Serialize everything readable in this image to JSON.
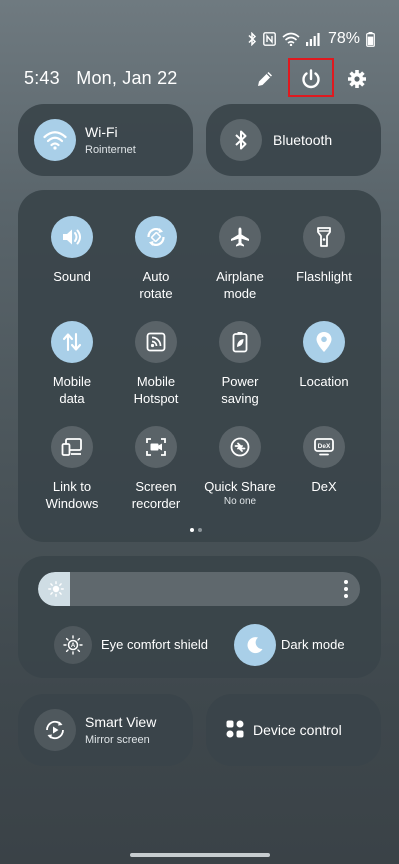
{
  "status_bar": {
    "battery": "78%",
    "icons": [
      "bluetooth-icon",
      "nfc-icon",
      "wifi-icon",
      "signal-icon",
      "battery-icon"
    ]
  },
  "header": {
    "time": "5:43",
    "date": "Mon, Jan 22",
    "icons": [
      "pencil-icon",
      "power-icon",
      "gear-icon"
    ]
  },
  "wifi": {
    "title": "Wi-Fi",
    "subtitle": "Rointernet",
    "state": "on"
  },
  "bluetooth": {
    "title": "Bluetooth",
    "state": "off"
  },
  "quick_settings": [
    {
      "label": "Sound",
      "icon": "speaker-icon",
      "state": "on"
    },
    {
      "label": "Auto\nrotate",
      "icon": "rotate-icon",
      "state": "on"
    },
    {
      "label": "Airplane\nmode",
      "icon": "airplane-icon",
      "state": "off"
    },
    {
      "label": "Flashlight",
      "icon": "flashlight-icon",
      "state": "off"
    },
    {
      "label": "Mobile\ndata",
      "icon": "data-arrows-icon",
      "state": "on"
    },
    {
      "label": "Mobile\nHotspot",
      "icon": "hotspot-icon",
      "state": "off"
    },
    {
      "label": "Power\nsaving",
      "icon": "battery-leaf-icon",
      "state": "off"
    },
    {
      "label": "Location",
      "icon": "location-pin-icon",
      "state": "on"
    },
    {
      "label": "Link to\nWindows",
      "icon": "link-windows-icon",
      "state": "off"
    },
    {
      "label": "Screen\nrecorder",
      "icon": "screen-recorder-icon",
      "state": "off"
    },
    {
      "label": "Quick Share",
      "sublabel": "No one",
      "icon": "quick-share-icon",
      "state": "off"
    },
    {
      "label": "DeX",
      "icon": "dex-icon",
      "state": "off"
    }
  ],
  "page_indicator": {
    "pages": 2,
    "current": 1
  },
  "brightness": {
    "level": 0.1
  },
  "eye_comfort": {
    "label": "Eye comfort shield",
    "state": "off"
  },
  "dark_mode": {
    "label": "Dark mode",
    "state": "on"
  },
  "smart_view": {
    "title": "Smart View",
    "subtitle": "Mirror screen"
  },
  "device_control": {
    "title": "Device control"
  },
  "colors": {
    "accent_on": "#a9cfe8",
    "highlight": "#e0191f"
  }
}
